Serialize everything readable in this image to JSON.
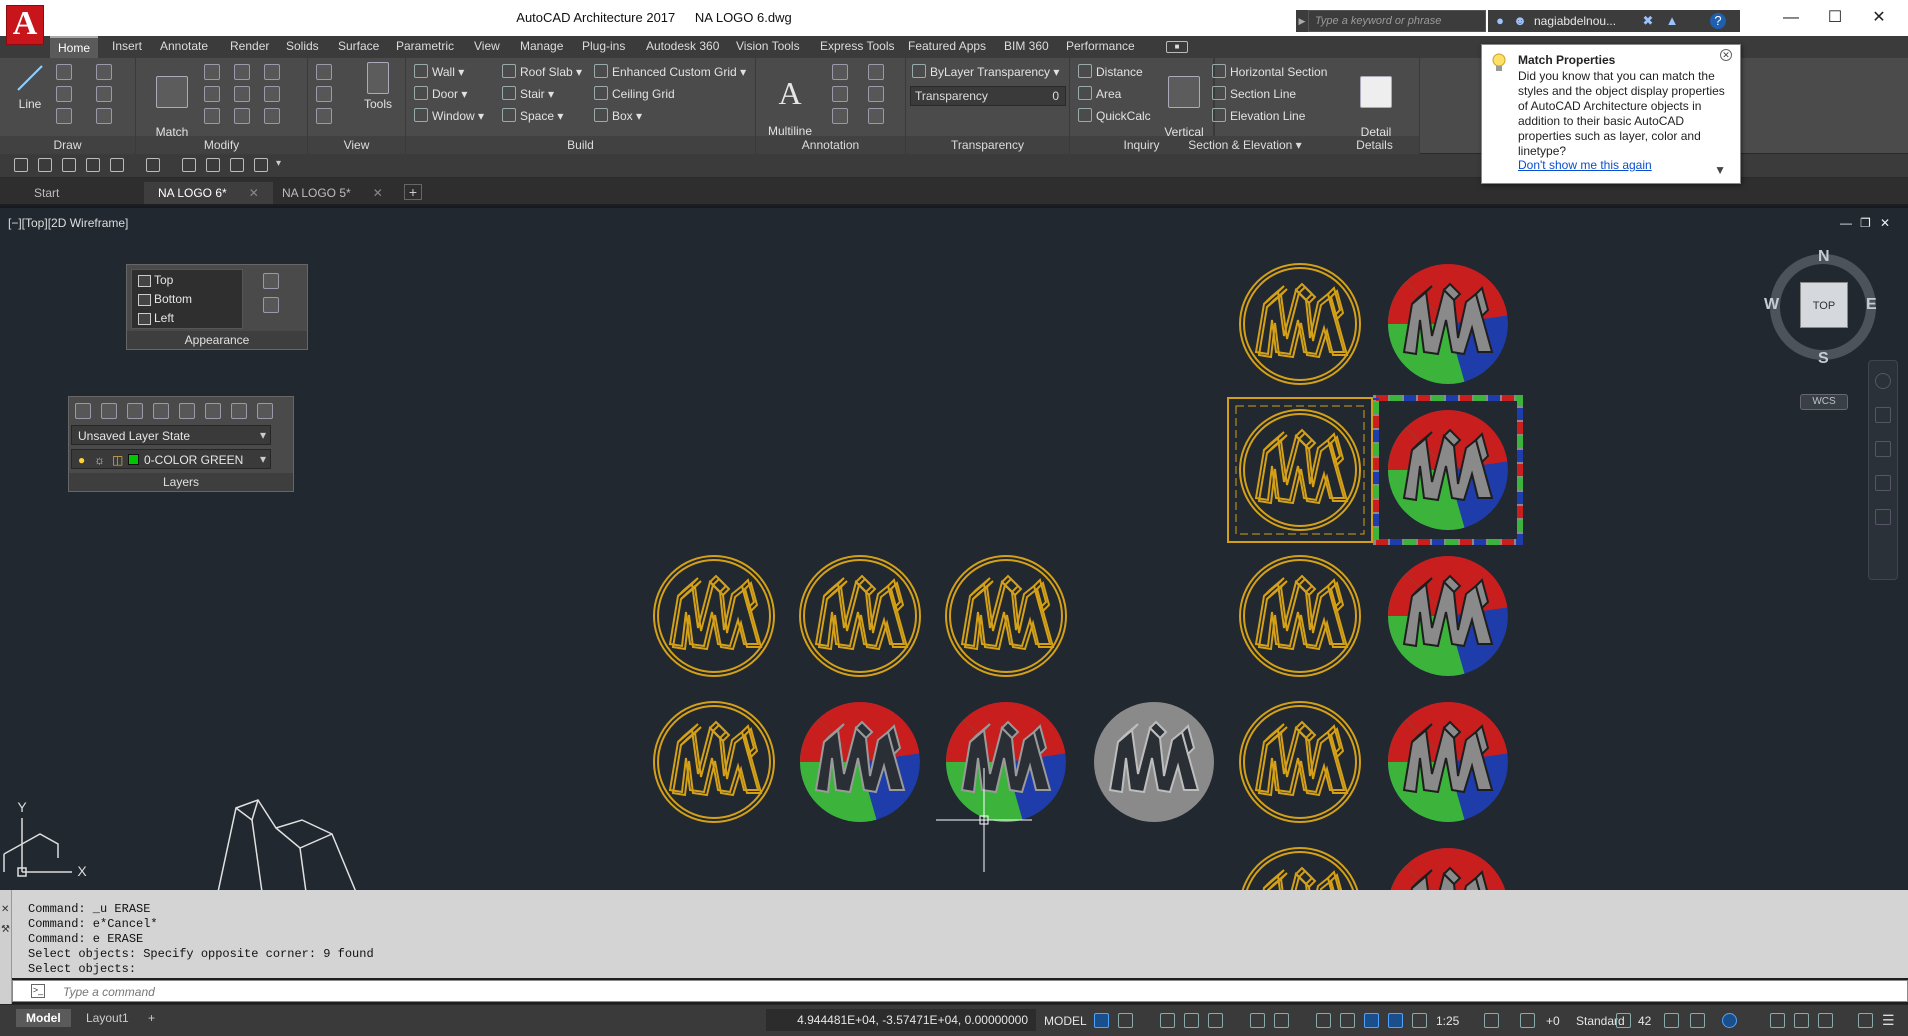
{
  "app": {
    "logo_letter": "A",
    "title": "AutoCAD Architecture 2017",
    "document": "NA LOGO 6.dwg",
    "search_placeholder": "Type a keyword or phrase",
    "user": "nagiabdelnou...",
    "window_controls": [
      "minimize-icon",
      "maximize-icon",
      "close-icon"
    ]
  },
  "ribbon_tabs": [
    {
      "label": "Home",
      "active": true
    },
    {
      "label": "Insert"
    },
    {
      "label": "Annotate"
    },
    {
      "label": "Render"
    },
    {
      "label": "Solids"
    },
    {
      "label": "Surface"
    },
    {
      "label": "Parametric"
    },
    {
      "label": "View"
    },
    {
      "label": "Manage"
    },
    {
      "label": "Plug-ins"
    },
    {
      "label": "Autodesk 360"
    },
    {
      "label": "Vision Tools"
    },
    {
      "label": "Express Tools"
    },
    {
      "label": "Featured Apps"
    },
    {
      "label": "BIM 360"
    },
    {
      "label": "Performance"
    }
  ],
  "ribbon": {
    "draw": {
      "title": "Draw",
      "line": "Line"
    },
    "modify": {
      "title": "Modify",
      "match": "Match\nProperties"
    },
    "view": {
      "title": "View",
      "tools": "Tools"
    },
    "build": {
      "title": "Build",
      "items": [
        "Wall",
        "Door",
        "Window",
        "Roof Slab",
        "Stair",
        "Space",
        "Enhanced Custom Grid",
        "Ceiling Grid",
        "Box"
      ]
    },
    "annotation": {
      "title": "Annotation",
      "multiline": "Multiline\nText"
    },
    "transparency": {
      "title": "Transparency",
      "bylayer": "ByLayer Transparency",
      "label": "Transparency",
      "value": "0"
    },
    "inquiry": {
      "title": "Inquiry",
      "items": [
        "Distance",
        "Area",
        "QuickCalc"
      ]
    },
    "section": {
      "title": "Section & Elevation",
      "vertical": "Vertical\nSection",
      "items": [
        "Horizontal Section",
        "Section Line",
        "Elevation Line"
      ]
    },
    "details": {
      "title": "Details",
      "detail": "Detail\nComponents"
    }
  },
  "file_tabs": [
    {
      "label": "Start"
    },
    {
      "label": "NA LOGO 6*",
      "active": true
    },
    {
      "label": "NA LOGO 5*"
    }
  ],
  "viewport": {
    "label": "[−][Top][2D Wireframe]",
    "appearance": {
      "title": "Appearance",
      "views": [
        "Top",
        "Bottom",
        "Left"
      ]
    },
    "layers": {
      "title": "Layers",
      "state": "Unsaved Layer State",
      "current": "0-COLOR GREEN",
      "current_color": "#00c800"
    },
    "viewcube": {
      "n": "N",
      "s": "S",
      "e": "E",
      "w": "W",
      "face": "TOP",
      "wcs": "WCS"
    },
    "ucs": {
      "x": "X",
      "y": "Y"
    },
    "colors": {
      "gold": "#d4a017",
      "red": "#c81e1e",
      "green": "#3cb43c",
      "blue": "#1e3caa",
      "gray": "#8a8a8a",
      "dark": "#2a2f36"
    }
  },
  "tooltip": {
    "title": "Match Properties",
    "body": "Did you know that you can match the styles and the object display properties of AutoCAD Architecture objects in addition to their basic AutoCAD properties such as layer, color and linetype?",
    "link": "Don't show me this again"
  },
  "command": {
    "history": [
      "Command: _u ERASE",
      "Command: e*Cancel*",
      "Command: e ERASE",
      "Select objects: Specify opposite corner: 9 found",
      "Select objects:"
    ],
    "placeholder": "Type a command"
  },
  "status": {
    "layouts": [
      {
        "label": "Model",
        "active": true
      },
      {
        "label": "Layout1"
      }
    ],
    "coords": "4.944481E+04, -3.57471E+04, 0.00000000",
    "space": "MODEL",
    "scale": "1:25",
    "style": "Standard",
    "number": "42",
    "offset": "+0"
  }
}
